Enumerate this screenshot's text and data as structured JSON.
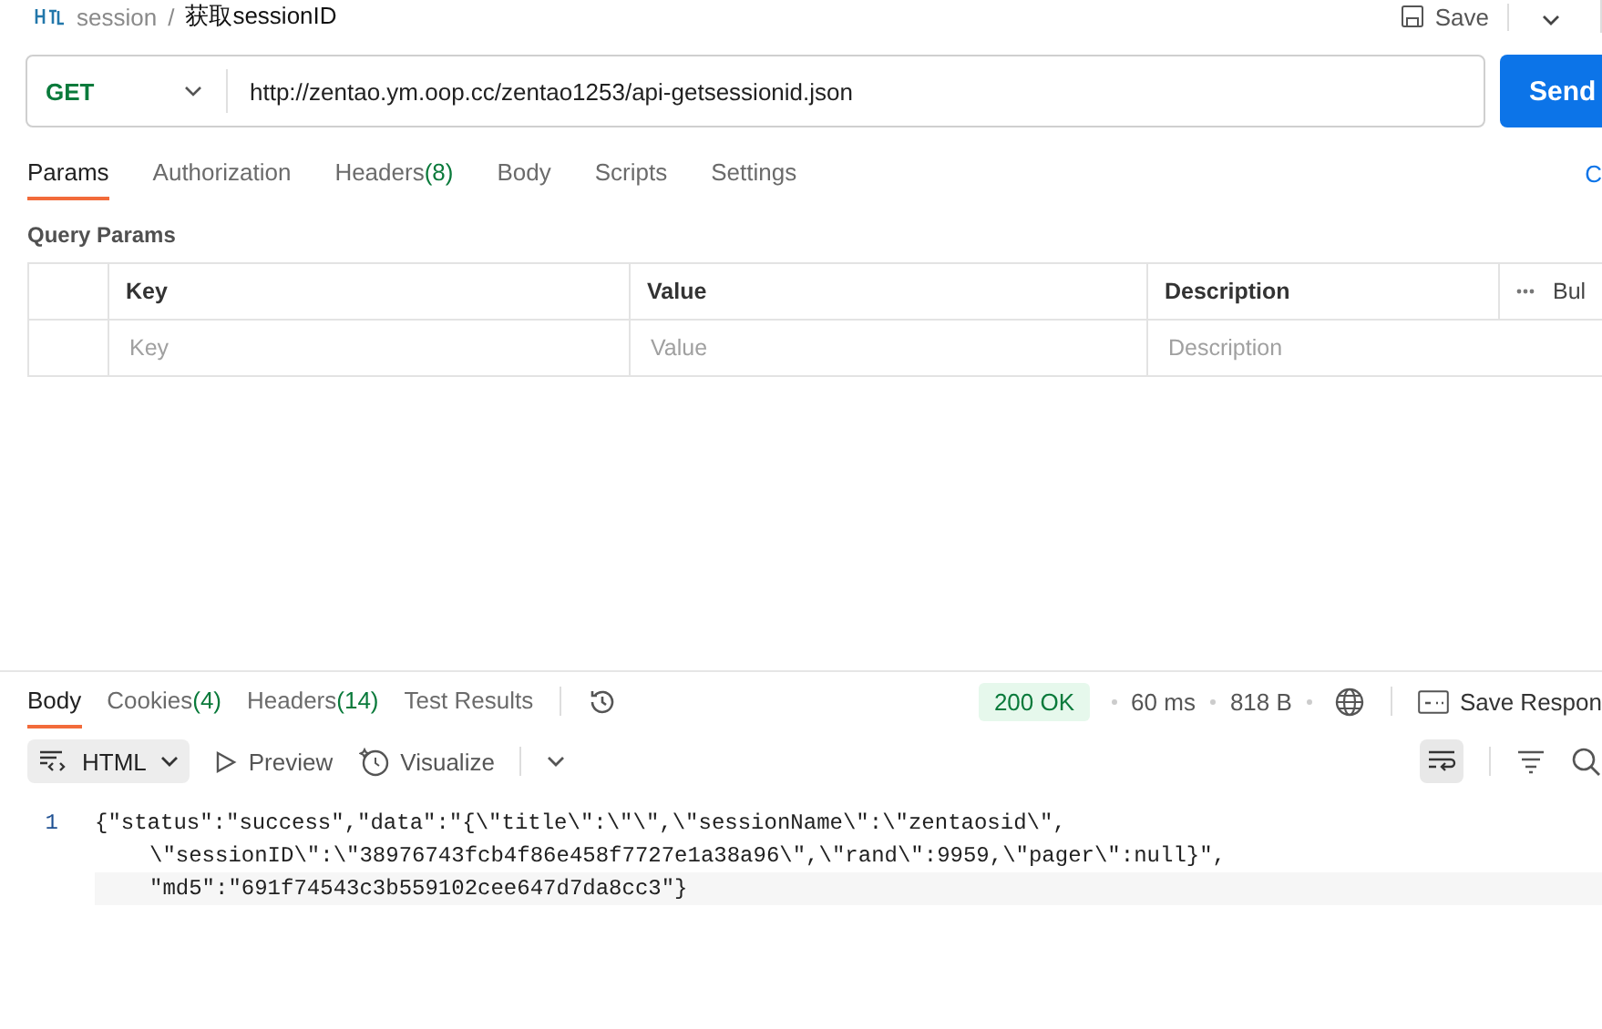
{
  "breadcrumb": {
    "parent": "session",
    "separator": "/",
    "current": "获取sessionID",
    "save": "Save"
  },
  "request": {
    "method": "GET",
    "url": "http://zentao.ym.oop.cc/zentao1253/api-getsessionid.json",
    "send": "Send"
  },
  "request_tabs": [
    {
      "label": "Params",
      "selected": true
    },
    {
      "label": "Authorization",
      "selected": false
    },
    {
      "label": "Headers",
      "count": "(8)",
      "selected": false
    },
    {
      "label": "Body",
      "selected": false
    },
    {
      "label": "Scripts",
      "selected": false
    },
    {
      "label": "Settings",
      "selected": false
    }
  ],
  "cookies_link": "C",
  "query_params": {
    "title": "Query Params",
    "columns": [
      "Key",
      "Value",
      "Description"
    ],
    "bulk_edit": "Bul",
    "placeholders": [
      "Key",
      "Value",
      "Description"
    ]
  },
  "response_tabs": [
    {
      "label": "Body",
      "selected": true
    },
    {
      "label": "Cookies",
      "count": "(4)",
      "selected": false
    },
    {
      "label": "Headers",
      "count": "(14)",
      "selected": false
    },
    {
      "label": "Test Results",
      "selected": false
    }
  ],
  "status": {
    "code": "200 OK",
    "time": "60 ms",
    "size": "818 B",
    "save_response": "Save Respon"
  },
  "response_toolbar": {
    "format": "HTML",
    "preview": "Preview",
    "visualize": "Visualize",
    "wrap_on": true
  },
  "code_lines": [
    {
      "number": "1",
      "segments": [
        "{\"status\":\"success\",\"data\":\"{\\\"title\\\":\\\"\\\",\\\"sessionName\\\":\\\"zentaosid\\\",",
        "\\\"sessionID\\\":\\\"38976743fcb4f86e458f7727e1a38a96\\\",\\\"rand\\\":9959,\\\"pager\\\":null}\",",
        "\"md5\":\"691f74543c3b559102cee647d7da8cc3\"}"
      ]
    }
  ]
}
